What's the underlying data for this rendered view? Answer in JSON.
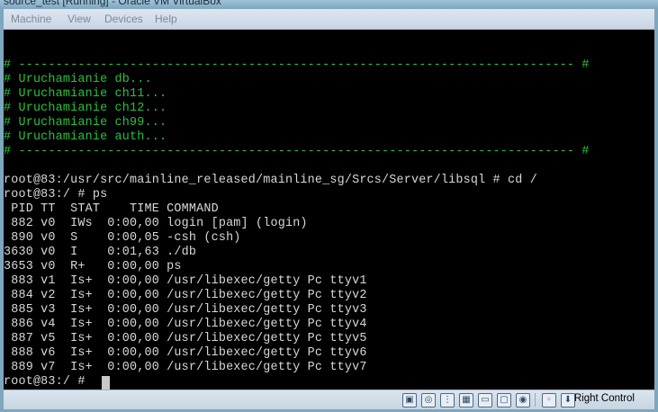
{
  "window": {
    "title": "source_test [Running] - Oracle VM VirtualBox"
  },
  "menubar": {
    "items": [
      "Machine",
      "View",
      "Devices",
      "Help"
    ]
  },
  "terminal": {
    "boot_lines": [
      "# --------------------------------------------------------------------------- #",
      "# Uruchamianie db...",
      "# Uruchamianie ch11...",
      "# Uruchamianie ch12...",
      "# Uruchamianie ch99...",
      "# Uruchamianie auth...",
      "# --------------------------------------------------------------------------- #"
    ],
    "session_lines": [
      "root@83:/usr/src/mainline_released/mainline_sg/Srcs/Server/libsql # cd /",
      "root@83:/ # ps",
      " PID TT  STAT    TIME COMMAND",
      " 882 v0  IWs  0:00,00 login [pam] (login)",
      " 890 v0  S    0:00,05 -csh (csh)",
      "3630 v0  I    0:01,63 ./db",
      "3653 v0  R+   0:00,00 ps",
      " 883 v1  Is+  0:00,00 /usr/libexec/getty Pc ttyv1",
      " 884 v2  Is+  0:00,00 /usr/libexec/getty Pc ttyv2",
      " 885 v3  Is+  0:00,00 /usr/libexec/getty Pc ttyv3",
      " 886 v4  Is+  0:00,00 /usr/libexec/getty Pc ttyv4",
      " 887 v5  Is+  0:00,00 /usr/libexec/getty Pc ttyv5",
      " 888 v6  Is+  0:00,00 /usr/libexec/getty Pc ttyv6",
      " 889 v7  Is+  0:00,00 /usr/libexec/getty Pc ttyv7",
      "root@83:/ #"
    ],
    "colors": {
      "background": "#000000",
      "boot_text": "#28c23b",
      "text": "#d8d8d8"
    }
  },
  "statusbar": {
    "icons": [
      "hard-disk-icon",
      "optical-drive-icon",
      "usb-icon",
      "network-icon",
      "shared-folders-icon",
      "display-icon",
      "video-capture-icon",
      "mouse-integration-icon",
      "host-key-icon"
    ],
    "host_key_label": "Right Control"
  }
}
